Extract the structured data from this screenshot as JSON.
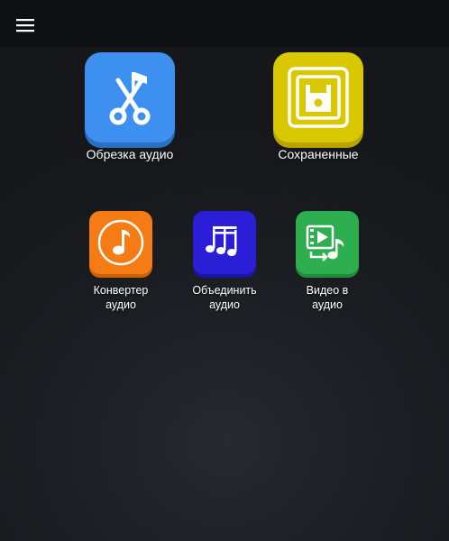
{
  "topbar": {
    "menu_icon": "hamburger-menu-icon"
  },
  "tiles": [
    {
      "label": "Обрезка аудио",
      "icon": "scissors-music-icon",
      "color": "#3d8ff0",
      "shadow": "#2b6fc4"
    },
    {
      "label": "Сохраненные",
      "icon": "floppy-disk-icon",
      "color": "#d9c700",
      "shadow": "#b7a400"
    },
    {
      "label": "Конвертер аудио",
      "icon": "music-note-circle-icon",
      "color": "#f57c14",
      "shadow": "#cf6008"
    },
    {
      "label": "Объединить аудио",
      "icon": "multiple-music-notes-icon",
      "color": "#2a1fd6",
      "shadow": "#1d14a8"
    },
    {
      "label": "Видео в аудио",
      "icon": "video-to-audio-icon",
      "color": "#2fae4f",
      "shadow": "#218a3b"
    }
  ],
  "colors": {
    "background": "#1a1d21",
    "topbar": "#0f1013"
  }
}
